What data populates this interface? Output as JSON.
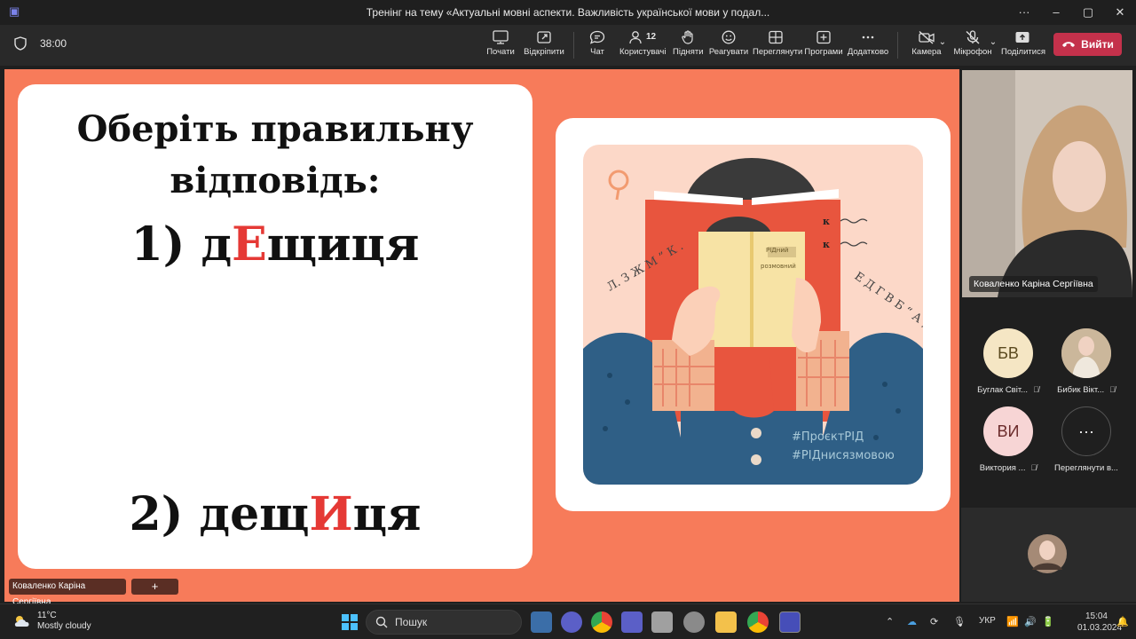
{
  "window": {
    "title": "Тренінг на тему «Актуальні мовні аспекти. Важливість української мови у подал...",
    "more": "···",
    "minimize": "–",
    "maximize": "▢",
    "close": "✕"
  },
  "toolbar": {
    "timer": "38:00",
    "buttons": [
      {
        "label": "Почати",
        "icon": "screen-record-icon"
      },
      {
        "label": "Відкріпити",
        "icon": "popout-icon"
      },
      {
        "label": "Чат",
        "icon": "chat-icon"
      },
      {
        "label": "Користувачі",
        "icon": "people-icon",
        "count": "12"
      },
      {
        "label": "Підняти",
        "icon": "raise-hand-icon"
      },
      {
        "label": "Реагувати",
        "icon": "emoji-icon"
      },
      {
        "label": "Переглянути",
        "icon": "view-icon"
      },
      {
        "label": "Програми",
        "icon": "apps-icon"
      },
      {
        "label": "Додатково",
        "icon": "more-icon"
      },
      {
        "label": "Камера",
        "icon": "camera-off-icon"
      },
      {
        "label": "Мікрофон",
        "icon": "mic-off-icon"
      },
      {
        "label": "Поділитися",
        "icon": "share-icon"
      }
    ],
    "leave_label": "Вийти"
  },
  "slide": {
    "title_line1": "Оберіть правильну",
    "title_line2": "відповідь:",
    "option1": {
      "prefix": "1) д",
      "highlight": "Е",
      "suffix": "щиця"
    },
    "option2": {
      "prefix": "2) дещ",
      "highlight": "И",
      "suffix": "ця"
    },
    "poster": {
      "book_title_1": "РІДний",
      "book_title_2": "розмовний",
      "hashtag1": "#ПроєктРІД",
      "hashtag2": "#РІДнисязмовою",
      "letters_left": "Л. З Ж М ” К .",
      "letters_right": "Е Д Г В Б “ А ;",
      "k_letter": "к"
    }
  },
  "presenter_tag": "Коваленко Каріна Сергіївна",
  "presenter_tag_add": "+",
  "main_video_name": "Коваленко Каріна Сергіївна",
  "participants": [
    {
      "initials": "БВ",
      "name": "Буглак Світ...",
      "avatar_color": "#f5e6c4",
      "text_color": "#5b4a1f"
    },
    {
      "initials": "",
      "name": "Бибик Вікт...",
      "avatar_color": "#8a7b66",
      "text_color": "#fff"
    },
    {
      "initials": "ВИ",
      "name": "Виктория ...",
      "avatar_color": "#f7d5d5",
      "text_color": "#6b2b2b"
    },
    {
      "initials": "···",
      "name": "Переглянути в...",
      "avatar_color": "#1f1f1f",
      "text_color": "#fff"
    }
  ],
  "taskbar": {
    "weather_temp": "11°C",
    "weather_desc": "Mostly cloudy",
    "search_placeholder": "Пошук",
    "lang": "УКР",
    "time": "15:04",
    "date": "01.03.2024"
  }
}
